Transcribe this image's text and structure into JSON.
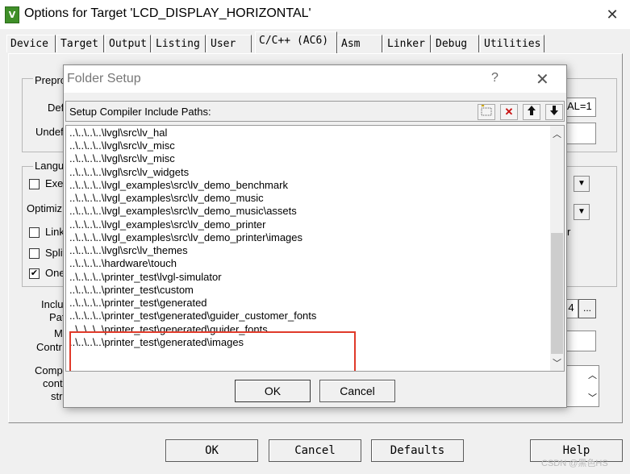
{
  "window": {
    "icon_text": "V",
    "title": "Options for Target 'LCD_DISPLAY_HORIZONTAL'",
    "close_symbol": "✕"
  },
  "tabs": [
    {
      "label": "Device"
    },
    {
      "label": "Target"
    },
    {
      "label": "Output"
    },
    {
      "label": "Listing"
    },
    {
      "label": "User"
    },
    {
      "label": "C/C++ (AC6)",
      "active": true
    },
    {
      "label": "Asm"
    },
    {
      "label": "Linker"
    },
    {
      "label": "Debug"
    },
    {
      "label": "Utilities"
    }
  ],
  "background_panel": {
    "preprocessor_label": "Prepro",
    "define_label": "Def",
    "define_value_tail": "AL=1",
    "undefine_label": "Undef",
    "language_label": "Langu",
    "execute_only_label": "Exe",
    "optimization_label": "Optimiz",
    "link_label": "Link",
    "split_label": "Split",
    "one_label": "One",
    "one_checked_mark": "✔",
    "include_label": "Inclu",
    "paths_label": "Pat",
    "misc_label": "Mi",
    "controls_label": "Contr",
    "compiler_label": "Comp",
    "control_label": "cont",
    "string_label": "stri",
    "r_fragment": "r",
    "include_btn_fragment": "4",
    "browse_label": "..."
  },
  "bottom_buttons": {
    "ok": "OK",
    "cancel": "Cancel",
    "defaults": "Defaults",
    "help": "Help"
  },
  "dialog": {
    "title": "Folder Setup",
    "help_symbol": "?",
    "close_symbol": "✕",
    "setup_label": "Setup Compiler Include Paths:",
    "toolbar_icons": [
      "new-folder-icon",
      "delete-icon",
      "move-up-icon",
      "move-down-icon"
    ],
    "paths": [
      "..\\..\\..\\..\\lvgl\\src\\lv_hal",
      "..\\..\\..\\..\\lvgl\\src\\lv_misc",
      "..\\..\\..\\..\\lvgl\\src\\lv_misc",
      "..\\..\\..\\..\\lvgl\\src\\lv_widgets",
      "..\\..\\..\\..\\lvgl_examples\\src\\lv_demo_benchmark",
      "..\\..\\..\\..\\lvgl_examples\\src\\lv_demo_music",
      "..\\..\\..\\..\\lvgl_examples\\src\\lv_demo_music\\assets",
      "..\\..\\..\\..\\lvgl_examples\\src\\lv_demo_printer",
      "..\\..\\..\\..\\lvgl_examples\\src\\lv_demo_printer\\images",
      "..\\..\\..\\..\\lvgl\\src\\lv_themes",
      "..\\..\\..\\..\\hardware\\touch",
      "..\\..\\..\\..\\printer_test\\lvgl-simulator",
      "..\\..\\..\\..\\printer_test\\custom",
      "..\\..\\..\\..\\printer_test\\generated",
      "..\\..\\..\\..\\printer_test\\generated\\guider_customer_fonts",
      "..\\..\\..\\..\\printer_test\\generated\\guider_fonts",
      "..\\..\\..\\..\\printer_test\\generated\\images"
    ],
    "ok": "OK",
    "cancel": "Cancel",
    "highlight_color": "#e03a2a"
  },
  "watermark": "CSDN @黑色HS"
}
